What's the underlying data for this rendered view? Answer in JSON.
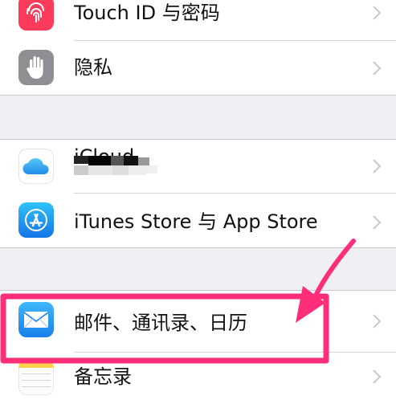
{
  "settings": {
    "rows": [
      {
        "label": "Touch ID 与密码",
        "icon": "fingerprint-icon"
      },
      {
        "label": "隐私",
        "icon": "hand-icon"
      },
      {
        "label": "iCloud",
        "icon": "cloud-icon"
      },
      {
        "label": "iTunes Store 与 App Store",
        "icon": "app-store-icon"
      },
      {
        "label": "邮件、通讯录、日历",
        "icon": "envelope-icon"
      },
      {
        "label": "备忘录",
        "icon": "notes-icon"
      }
    ]
  },
  "colors": {
    "background": "#efeff4",
    "annotation": "#ff2d7a",
    "touch_id_icon": "#ff3b5c",
    "privacy_icon": "#8e8e93",
    "mail_icon": "#1e8ef5",
    "app_store_icon": "#1a9bf0",
    "notes_icon": "#ffd34a"
  }
}
